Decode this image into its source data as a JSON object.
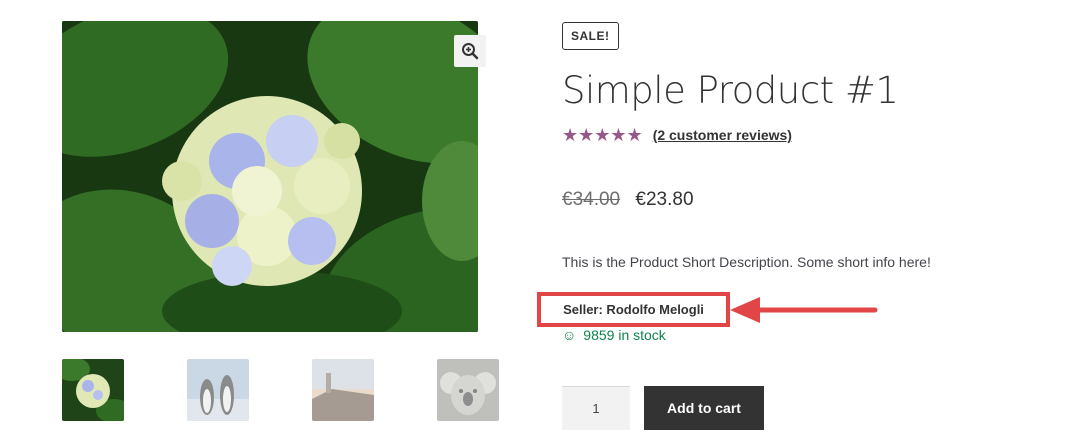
{
  "gallery": {
    "main_image": "hydrangea-flower-image",
    "zoom_icon": "zoom-in-icon",
    "thumbnails": [
      {
        "name": "hydrangea-thumbnail",
        "active": true
      },
      {
        "name": "penguins-thumbnail",
        "active": false
      },
      {
        "name": "lighthouse-thumbnail",
        "active": false
      },
      {
        "name": "koala-thumbnail",
        "active": false
      }
    ]
  },
  "product": {
    "badge": "SALE!",
    "title": "Simple Product #1",
    "rating_stars": "★★★★★",
    "rating": 5,
    "reviews_link": "(2 customer reviews)",
    "price_old": "€34.00",
    "price_new": "€23.80",
    "short_description": "This is the Product Short Description. Some short info here!",
    "seller": "Seller: Rodolfo Melogli",
    "stock_icon": "smiley-icon",
    "stock_text": "9859 in stock",
    "quantity": "1",
    "add_to_cart": "Add to cart"
  },
  "colors": {
    "star": "#96588a",
    "stock": "#0f834d",
    "highlight": "#e14545",
    "button_bg": "#333333"
  }
}
